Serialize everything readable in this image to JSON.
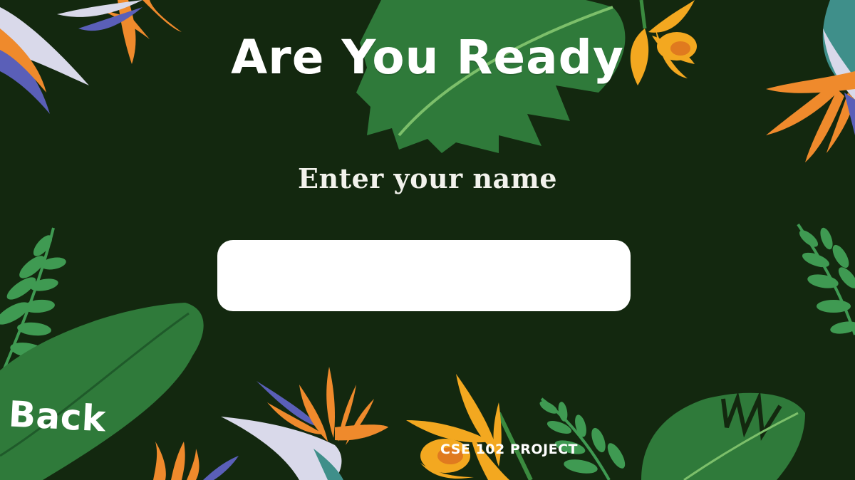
{
  "screen": {
    "title": "Are You Ready",
    "prompt": "Enter your name",
    "name_input": {
      "value": "",
      "placeholder": ""
    },
    "back_label": "Back",
    "footer_label": "CSE 102 PROJECT"
  },
  "colors": {
    "background": "#13280f",
    "leaf_green": "#2f7a3a",
    "leaf_dark": "#1f5a2a",
    "fern_green": "#3f9a52",
    "bird_orange": "#ef8a2c",
    "bird_purple": "#5a5fb8",
    "orchid_yellow": "#f3a820",
    "text": "#ffffff",
    "input_bg": "#ffffff"
  },
  "decorations": [
    "monstera-leaf",
    "banana-leaf",
    "fern-leaf",
    "bird-of-paradise-flower",
    "orchid-flower"
  ]
}
